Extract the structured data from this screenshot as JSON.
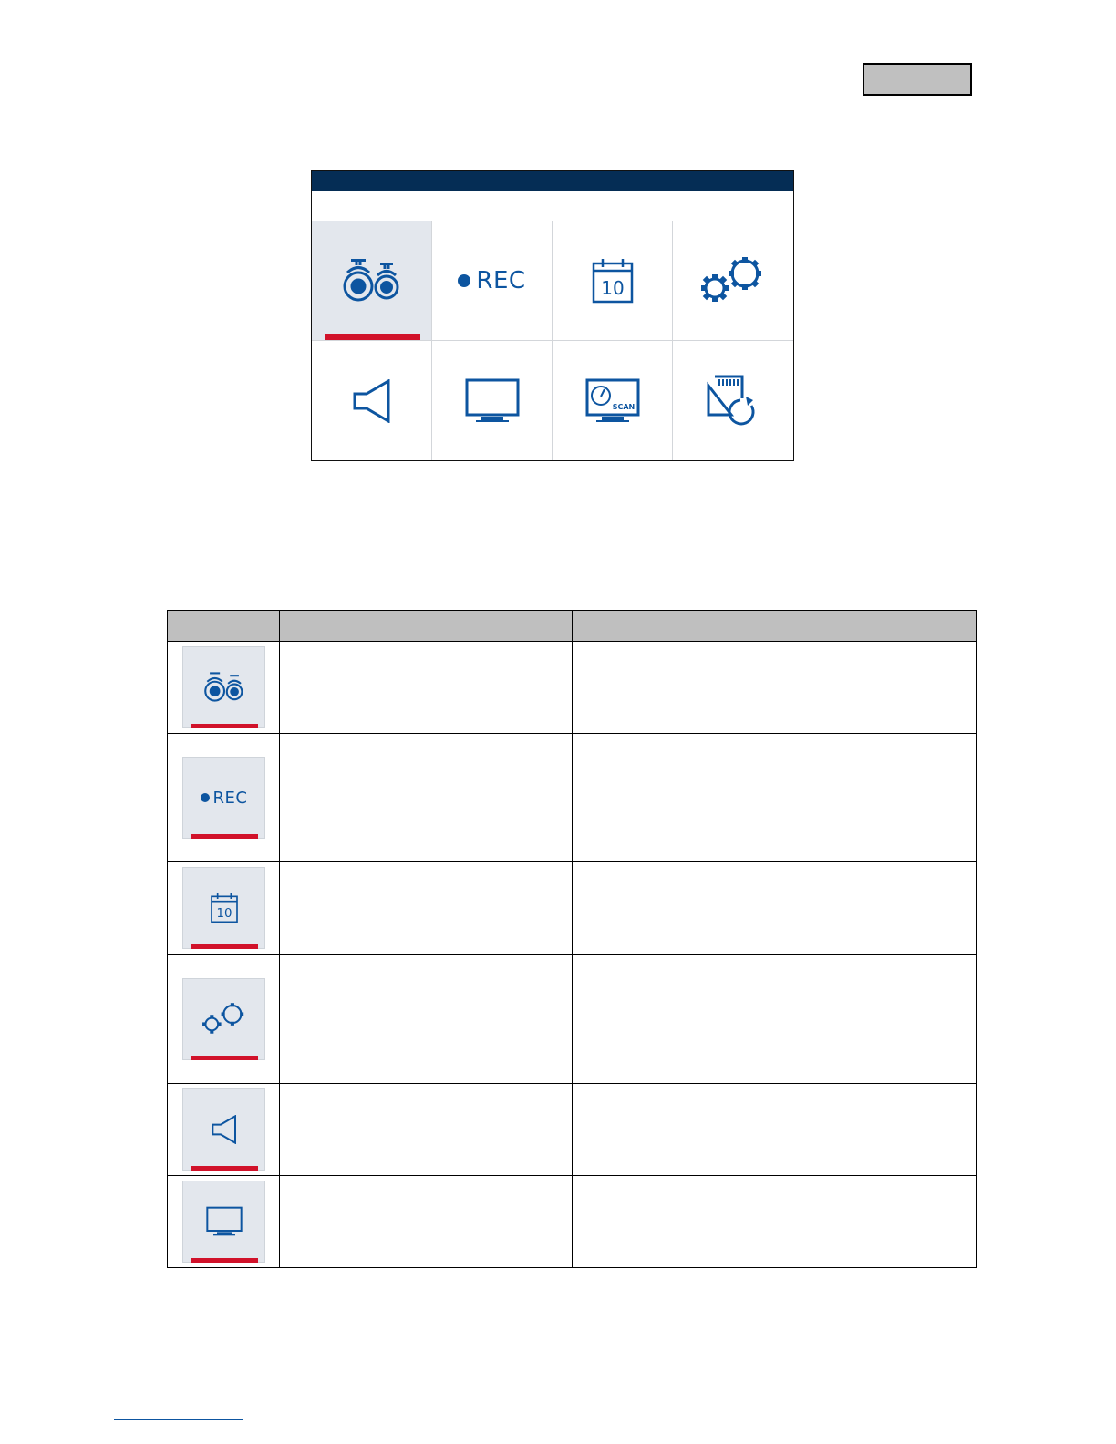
{
  "header": {
    "language_box": ""
  },
  "device_screen": {
    "title_bar": "",
    "subtitle": "",
    "tiles": [
      {
        "icon": "cameras-icon",
        "label": "",
        "selected": true
      },
      {
        "icon": "rec-icon",
        "label": "REC",
        "selected": false
      },
      {
        "icon": "calendar-icon",
        "label": "10",
        "selected": false
      },
      {
        "icon": "settings-gears-icon",
        "label": "",
        "selected": false
      },
      {
        "icon": "speaker-icon",
        "label": "",
        "selected": false
      },
      {
        "icon": "monitor-icon",
        "label": "",
        "selected": false
      },
      {
        "icon": "monitor-scan-icon",
        "label": "SCAN",
        "selected": false
      },
      {
        "icon": "sd-card-format-icon",
        "label": "",
        "selected": false
      }
    ]
  },
  "doc": {
    "heading": ""
  },
  "table": {
    "headers": [
      "",
      "",
      ""
    ],
    "rows": [
      {
        "icon": "cameras-icon",
        "name": "",
        "description": ""
      },
      {
        "icon": "rec-icon",
        "icon_text": "REC",
        "name": "",
        "description": ""
      },
      {
        "icon": "calendar-icon",
        "icon_text": "10",
        "name": "",
        "description": ""
      },
      {
        "icon": "settings-gears-icon",
        "name": "",
        "description": ""
      },
      {
        "icon": "speaker-icon",
        "name": "",
        "description": ""
      },
      {
        "icon": "monitor-icon",
        "name": "",
        "description": ""
      }
    ]
  },
  "footer": {
    "link_text": ""
  },
  "colors": {
    "navy": "#052d55",
    "icon_blue": "#0d55a0",
    "accent_red": "#d1122a",
    "tile_selected": "#e3e7ed",
    "header_gray": "#bfbfbf"
  }
}
